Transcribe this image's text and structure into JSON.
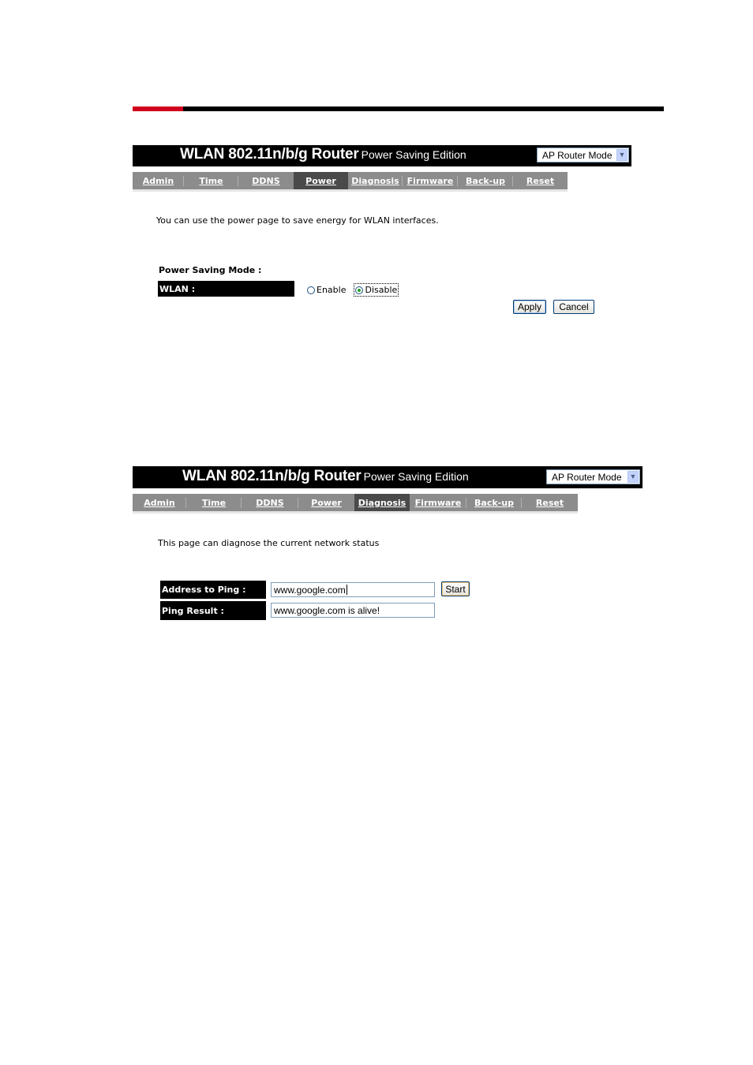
{
  "header_rule": {
    "accent_color": "#d2001c",
    "line_color": "#000000"
  },
  "screenshots": [
    {
      "banner": {
        "title_main": "WLAN 802.11n/b/g Router",
        "title_sub": "Power Saving Edition",
        "mode_select": {
          "value": "AP Router Mode",
          "icon": "chevron-down-icon"
        }
      },
      "nav": {
        "tabs": [
          "Admin",
          "Time",
          "DDNS",
          "Power",
          "Diagnosis",
          "Firmware",
          "Back-up",
          "Reset"
        ],
        "active": "Power"
      },
      "description": "You can use the power page to save energy for WLAN interfaces.",
      "section_label": "Power Saving Mode :",
      "wlan_label": "WLAN :",
      "radio": {
        "enable_label": "Enable",
        "disable_label": "Disable",
        "selected": "Disable"
      },
      "buttons": {
        "apply": "Apply",
        "cancel": "Cancel"
      }
    },
    {
      "banner": {
        "title_main": "WLAN 802.11n/b/g Router",
        "title_sub": "Power Saving Edition",
        "mode_select": {
          "value": "AP Router Mode",
          "icon": "chevron-down-icon"
        }
      },
      "nav": {
        "tabs": [
          "Admin",
          "Time",
          "DDNS",
          "Power",
          "Diagnosis",
          "Firmware",
          "Back-up",
          "Reset"
        ],
        "active": "Diagnosis"
      },
      "description": "This page can diagnose the current network status",
      "address_label": "Address to Ping :",
      "address_value": "www.google.com",
      "result_label": "Ping Result :",
      "result_value": "www.google.com is alive!",
      "buttons": {
        "start": "Start"
      }
    }
  ]
}
